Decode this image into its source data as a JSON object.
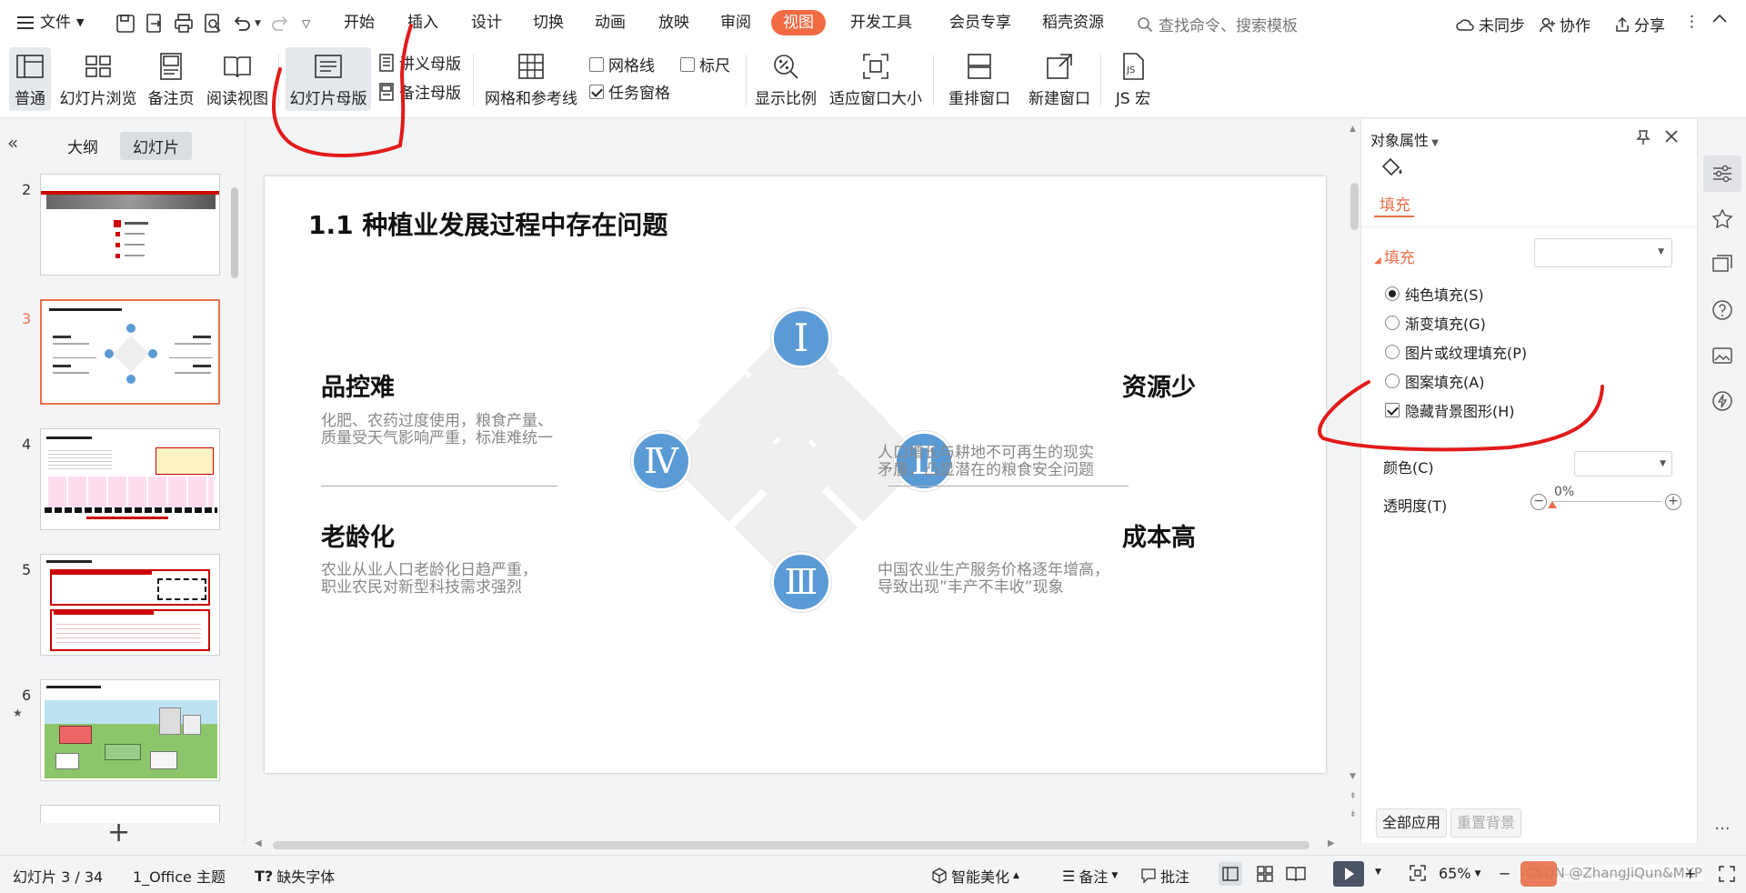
{
  "menubar": {
    "file_label": "文件",
    "tabs": [
      "开始",
      "插入",
      "设计",
      "切换",
      "动画",
      "放映",
      "审阅",
      "视图",
      "开发工具",
      "会员专享",
      "稻壳资源"
    ],
    "active_tab": "视图",
    "search_placeholder": "查找命令、搜索模板",
    "sync_label": "未同步",
    "collab_label": "协作",
    "share_label": "分享"
  },
  "ribbon": {
    "normal": "普通",
    "slide_browse": "幻灯片浏览",
    "notes_page": "备注页",
    "reading_view": "阅读视图",
    "slide_master": "幻灯片母版",
    "handout_master": "讲义母版",
    "notes_master": "备注母版",
    "grid_guides": "网格和参考线",
    "gridlines": "网格线",
    "ruler": "标尺",
    "task_pane": "任务窗格",
    "zoom": "显示比例",
    "fit_window": "适应窗口大小",
    "rearrange": "重排窗口",
    "new_window": "新建窗口",
    "js_macro": "JS 宏"
  },
  "left_pane": {
    "tab_outline": "大纲",
    "tab_slides": "幻灯片",
    "thumb_numbers": [
      "2",
      "3",
      "4",
      "5",
      "6"
    ],
    "selected": "3"
  },
  "slide": {
    "title": "1.1 种植业发展过程中存在问题",
    "q1_title": "品控难",
    "q1_text1": "化肥、农药过度使用，粮食产量、",
    "q1_text2": "质量受天气影响严重，标准难统一",
    "q2_title": "资源少",
    "q2_text1": "人口增长与耕地不可再生的现实",
    "q2_text2": "矛盾，凸显潜在的粮食安全问题",
    "q3_title": "老龄化",
    "q3_text1": "农业从业人口老龄化日趋严重，",
    "q3_text2": "职业农民对新型科技需求强烈",
    "q4_title": "成本高",
    "q4_text1": "中国农业生产服务价格逐年增高，",
    "q4_text2": "导致出现”丰产不丰收”现象",
    "numerals": [
      "Ⅰ",
      "Ⅱ",
      "Ⅲ",
      "Ⅳ"
    ],
    "circle_color": "#5b9bd5"
  },
  "right_panel": {
    "title": "对象属性",
    "tab_fill": "填充",
    "section_fill": "填充",
    "opt_solid": "纯色填充(S)",
    "opt_gradient": "渐变填充(G)",
    "opt_picture": "图片或纹理填充(P)",
    "opt_pattern": "图案填充(A)",
    "opt_hide_bg": "隐藏背景图形(H)",
    "color_label": "颜色(C)",
    "transparency_label": "透明度(T)",
    "transparency_value": "0%",
    "apply_all": "全部应用",
    "reset_bg": "重置背景"
  },
  "statusbar": {
    "slide_info": "幻灯片 3 / 34",
    "theme": "1_Office 主题",
    "missing_font": "缺失字体",
    "smart_beautify": "智能美化",
    "notes": "备注",
    "comments": "批注",
    "zoom": "65%",
    "watermark": "CSDN @ZhangJiQun&MXP"
  },
  "colors": {
    "accent": "#f06a43",
    "circle": "#5b9bd5",
    "annotation": "#e21a1a"
  }
}
